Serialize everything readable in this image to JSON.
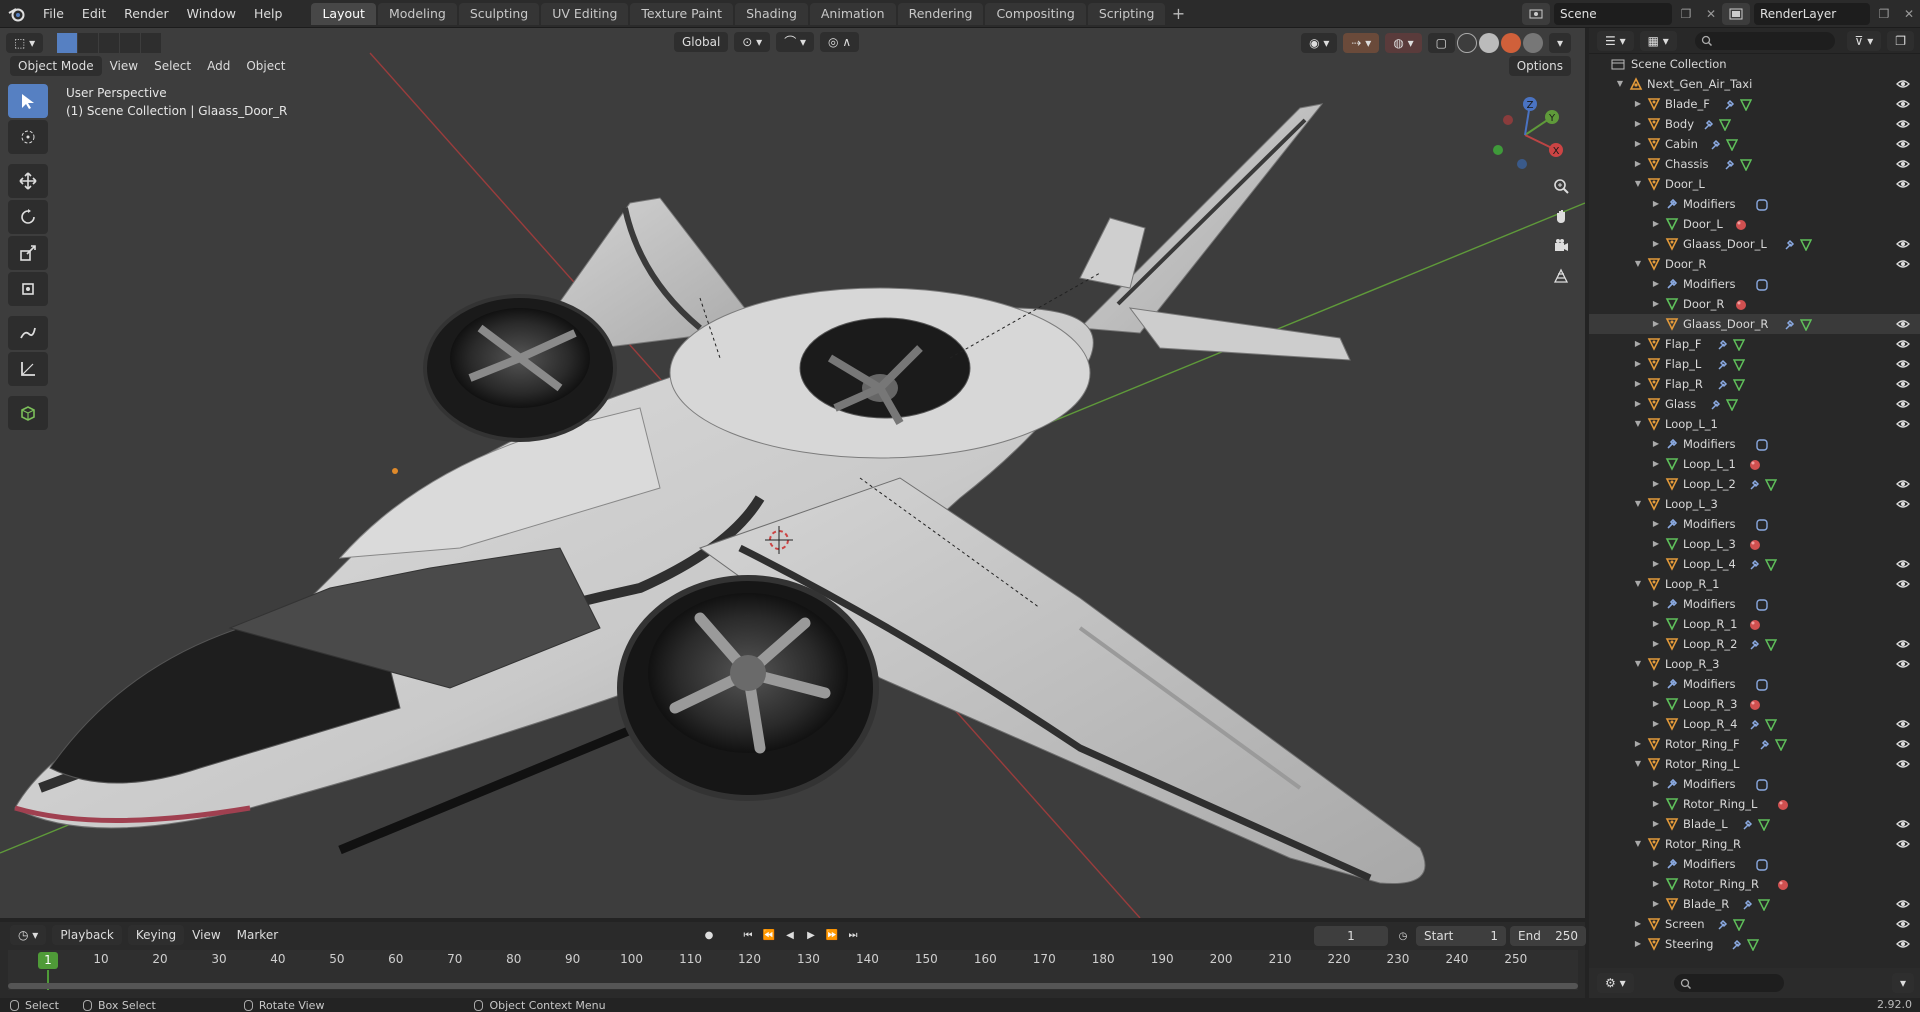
{
  "topbar": {
    "menus": [
      "File",
      "Edit",
      "Render",
      "Window",
      "Help"
    ],
    "workspaces": [
      "Layout",
      "Modeling",
      "Sculpting",
      "UV Editing",
      "Texture Paint",
      "Shading",
      "Animation",
      "Rendering",
      "Compositing",
      "Scripting"
    ],
    "active_workspace": "Layout",
    "scene_name": "Scene",
    "render_layer": "RenderLayer"
  },
  "viewport": {
    "mode": "Object Mode",
    "menus": [
      "View",
      "Select",
      "Add",
      "Object"
    ],
    "transform_orientation": "Global",
    "options_label": "Options",
    "perspective_label": "User Perspective",
    "context_label": "(1) Scene Collection | Glaass_Door_R",
    "gizmo": {
      "x": "X",
      "y": "Y",
      "z": "Z"
    },
    "colors": {
      "bg": "#3d3d3d",
      "x_axis": "#a23a3a",
      "y_axis": "#5b9a3a",
      "accent": "#5680c2"
    }
  },
  "outliner": {
    "root": "Scene Collection",
    "collection": "Next_Gen_Air_Taxi",
    "rows": [
      {
        "label": "Blade_F",
        "level": 2,
        "kind": "object",
        "arrow": "right",
        "extras": [
          "wrench",
          "mesh"
        ],
        "eye": true
      },
      {
        "label": "Body",
        "level": 2,
        "kind": "object",
        "arrow": "right",
        "extras": [
          "wrench",
          "mesh"
        ],
        "eye": true
      },
      {
        "label": "Cabin",
        "level": 2,
        "kind": "object",
        "arrow": "right",
        "extras": [
          "wrench",
          "mesh"
        ],
        "eye": true
      },
      {
        "label": "Chassis",
        "level": 2,
        "kind": "object",
        "arrow": "right",
        "extras": [
          "wrench",
          "mesh"
        ],
        "eye": true
      },
      {
        "label": "Door_L",
        "level": 2,
        "kind": "object",
        "arrow": "down",
        "extras": [],
        "eye": true
      },
      {
        "label": "Modifiers",
        "level": 3,
        "kind": "modifiers",
        "arrow": "right",
        "extras": [
          "mod"
        ],
        "eye": false
      },
      {
        "label": "Door_L",
        "level": 3,
        "kind": "mesh",
        "arrow": "right",
        "extras": [
          "mat"
        ],
        "eye": false
      },
      {
        "label": "Glaass_Door_L",
        "level": 3,
        "kind": "object",
        "arrow": "right",
        "extras": [
          "wrench",
          "mesh"
        ],
        "eye": true
      },
      {
        "label": "Door_R",
        "level": 2,
        "kind": "object",
        "arrow": "down",
        "extras": [],
        "eye": true
      },
      {
        "label": "Modifiers",
        "level": 3,
        "kind": "modifiers",
        "arrow": "right",
        "extras": [
          "mod"
        ],
        "eye": false
      },
      {
        "label": "Door_R",
        "level": 3,
        "kind": "mesh",
        "arrow": "right",
        "extras": [
          "mat"
        ],
        "eye": false
      },
      {
        "label": "Glaass_Door_R",
        "level": 3,
        "kind": "object",
        "arrow": "right",
        "extras": [
          "wrench",
          "mesh"
        ],
        "eye": true,
        "highlight": true
      },
      {
        "label": "Flap_F",
        "level": 2,
        "kind": "object",
        "arrow": "right",
        "extras": [
          "wrench",
          "mesh"
        ],
        "eye": true
      },
      {
        "label": "Flap_L",
        "level": 2,
        "kind": "object",
        "arrow": "right",
        "extras": [
          "wrench",
          "mesh"
        ],
        "eye": true
      },
      {
        "label": "Flap_R",
        "level": 2,
        "kind": "object",
        "arrow": "right",
        "extras": [
          "wrench",
          "mesh"
        ],
        "eye": true
      },
      {
        "label": "Glass",
        "level": 2,
        "kind": "object",
        "arrow": "right",
        "extras": [
          "wrench",
          "mesh"
        ],
        "eye": true
      },
      {
        "label": "Loop_L_1",
        "level": 2,
        "kind": "object",
        "arrow": "down",
        "extras": [],
        "eye": true
      },
      {
        "label": "Modifiers",
        "level": 3,
        "kind": "modifiers",
        "arrow": "right",
        "extras": [
          "mod"
        ],
        "eye": false
      },
      {
        "label": "Loop_L_1",
        "level": 3,
        "kind": "mesh",
        "arrow": "right",
        "extras": [
          "mat"
        ],
        "eye": false
      },
      {
        "label": "Loop_L_2",
        "level": 3,
        "kind": "object",
        "arrow": "right",
        "extras": [
          "wrench",
          "mesh"
        ],
        "eye": true
      },
      {
        "label": "Loop_L_3",
        "level": 2,
        "kind": "object",
        "arrow": "down",
        "extras": [],
        "eye": true
      },
      {
        "label": "Modifiers",
        "level": 3,
        "kind": "modifiers",
        "arrow": "right",
        "extras": [
          "mod"
        ],
        "eye": false
      },
      {
        "label": "Loop_L_3",
        "level": 3,
        "kind": "mesh",
        "arrow": "right",
        "extras": [
          "mat"
        ],
        "eye": false
      },
      {
        "label": "Loop_L_4",
        "level": 3,
        "kind": "object",
        "arrow": "right",
        "extras": [
          "wrench",
          "mesh"
        ],
        "eye": true
      },
      {
        "label": "Loop_R_1",
        "level": 2,
        "kind": "object",
        "arrow": "down",
        "extras": [],
        "eye": true
      },
      {
        "label": "Modifiers",
        "level": 3,
        "kind": "modifiers",
        "arrow": "right",
        "extras": [
          "mod"
        ],
        "eye": false
      },
      {
        "label": "Loop_R_1",
        "level": 3,
        "kind": "mesh",
        "arrow": "right",
        "extras": [
          "mat"
        ],
        "eye": false
      },
      {
        "label": "Loop_R_2",
        "level": 3,
        "kind": "object",
        "arrow": "right",
        "extras": [
          "wrench",
          "mesh"
        ],
        "eye": true
      },
      {
        "label": "Loop_R_3",
        "level": 2,
        "kind": "object",
        "arrow": "down",
        "extras": [],
        "eye": true
      },
      {
        "label": "Modifiers",
        "level": 3,
        "kind": "modifiers",
        "arrow": "right",
        "extras": [
          "mod"
        ],
        "eye": false
      },
      {
        "label": "Loop_R_3",
        "level": 3,
        "kind": "mesh",
        "arrow": "right",
        "extras": [
          "mat"
        ],
        "eye": false
      },
      {
        "label": "Loop_R_4",
        "level": 3,
        "kind": "object",
        "arrow": "right",
        "extras": [
          "wrench",
          "mesh"
        ],
        "eye": true
      },
      {
        "label": "Rotor_Ring_F",
        "level": 2,
        "kind": "object",
        "arrow": "right",
        "extras": [
          "wrench",
          "mesh"
        ],
        "eye": true
      },
      {
        "label": "Rotor_Ring_L",
        "level": 2,
        "kind": "object",
        "arrow": "down",
        "extras": [],
        "eye": true
      },
      {
        "label": "Modifiers",
        "level": 3,
        "kind": "modifiers",
        "arrow": "right",
        "extras": [
          "mod"
        ],
        "eye": false
      },
      {
        "label": "Rotor_Ring_L",
        "level": 3,
        "kind": "mesh",
        "arrow": "right",
        "extras": [
          "mat"
        ],
        "eye": false
      },
      {
        "label": "Blade_L",
        "level": 3,
        "kind": "object",
        "arrow": "right",
        "extras": [
          "wrench",
          "mesh"
        ],
        "eye": true
      },
      {
        "label": "Rotor_Ring_R",
        "level": 2,
        "kind": "object",
        "arrow": "down",
        "extras": [],
        "eye": true
      },
      {
        "label": "Modifiers",
        "level": 3,
        "kind": "modifiers",
        "arrow": "right",
        "extras": [
          "mod"
        ],
        "eye": false
      },
      {
        "label": "Rotor_Ring_R",
        "level": 3,
        "kind": "mesh",
        "arrow": "right",
        "extras": [
          "mat"
        ],
        "eye": false
      },
      {
        "label": "Blade_R",
        "level": 3,
        "kind": "object",
        "arrow": "right",
        "extras": [
          "wrench",
          "mesh"
        ],
        "eye": true
      },
      {
        "label": "Screen",
        "level": 2,
        "kind": "object",
        "arrow": "right",
        "extras": [
          "wrench",
          "mesh"
        ],
        "eye": true
      },
      {
        "label": "Steering",
        "level": 2,
        "kind": "object",
        "arrow": "right",
        "extras": [
          "wrench",
          "mesh"
        ],
        "eye": true
      }
    ]
  },
  "timeline": {
    "menus": [
      "Playback",
      "Keying",
      "View",
      "Marker"
    ],
    "current_frame": "1",
    "start_label": "Start",
    "start": "1",
    "end_label": "End",
    "end": "250",
    "ticks": [
      "10",
      "20",
      "30",
      "40",
      "50",
      "60",
      "70",
      "80",
      "90",
      "100",
      "110",
      "120",
      "130",
      "140",
      "150",
      "160",
      "170",
      "180",
      "190",
      "200",
      "210",
      "220",
      "230",
      "240",
      "250"
    ],
    "marker": "1"
  },
  "statusbar": {
    "select": "Select",
    "box_select": "Box Select",
    "rotate_view": "Rotate View",
    "context_menu": "Object Context Menu",
    "version": "2.92.0"
  }
}
